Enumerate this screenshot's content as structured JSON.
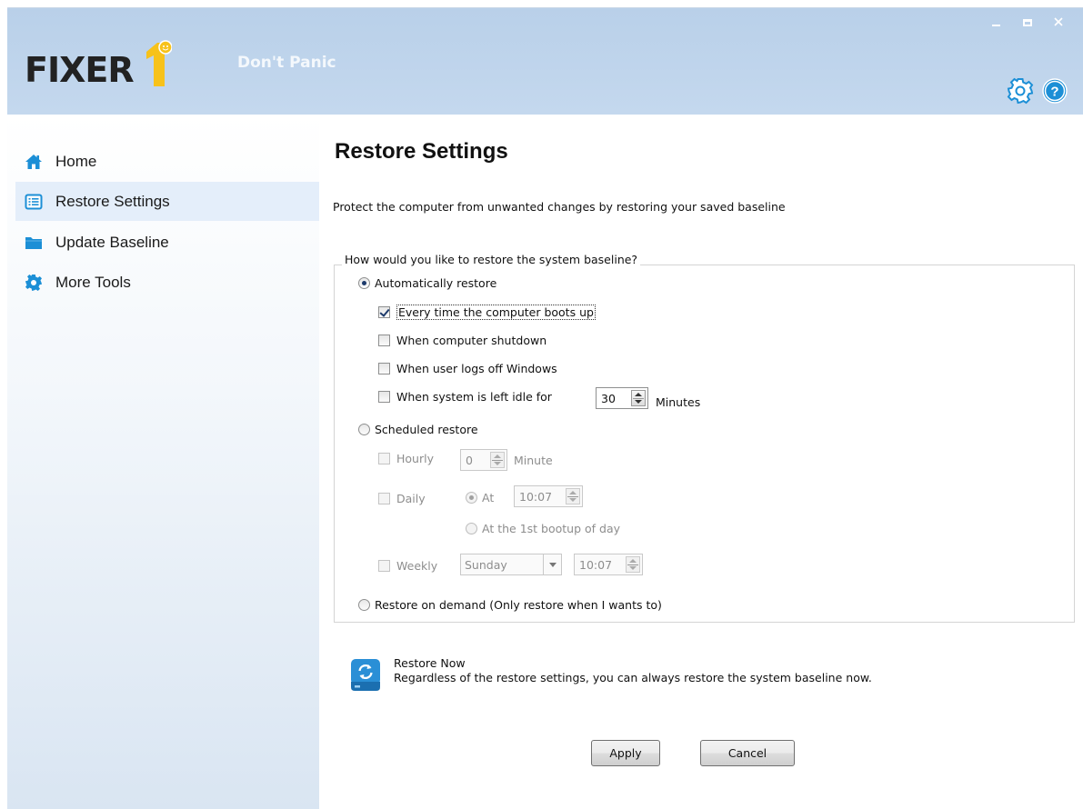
{
  "app": {
    "logo_text": "FIXER",
    "tagline": "Don't Panic"
  },
  "sidebar": {
    "items": [
      {
        "label": "Home",
        "icon": "home-icon",
        "active": false
      },
      {
        "label": "Restore Settings",
        "icon": "list-icon",
        "active": true
      },
      {
        "label": "Update Baseline",
        "icon": "folder-icon",
        "active": false
      },
      {
        "label": "More Tools",
        "icon": "gear-icon",
        "active": false
      }
    ]
  },
  "main": {
    "title": "Restore Settings",
    "description": "Protect the computer from unwanted changes by restoring your saved baseline",
    "group_label": "How would you like to restore the system baseline?",
    "auto_restore": {
      "label": "Automatically restore",
      "selected": true,
      "boot_label": "Every time the computer boots up",
      "boot_checked": true,
      "shutdown_label": "When computer shutdown",
      "shutdown_checked": false,
      "logoff_label": "When user logs off Windows",
      "logoff_checked": false,
      "idle_label": "When system is left idle for",
      "idle_checked": false,
      "idle_value": "30",
      "idle_unit": "Minutes"
    },
    "scheduled_restore": {
      "label": "Scheduled restore",
      "selected": false,
      "hourly_label": "Hourly",
      "hourly_value": "0",
      "hourly_unit": "Minute",
      "daily_label": "Daily",
      "daily_at_label": "At",
      "daily_time": "10:07",
      "daily_first_boot_label": "At the 1st bootup of day",
      "weekly_label": "Weekly",
      "weekly_day": "Sunday",
      "weekly_time": "10:07"
    },
    "on_demand": {
      "label": "Restore on demand (Only restore when I wants to)",
      "selected": false
    },
    "restore_now": {
      "title": "Restore Now",
      "description": "Regardless of the restore settings, you can always restore the system baseline now."
    },
    "buttons": {
      "apply": "Apply",
      "cancel": "Cancel"
    }
  },
  "colors": {
    "header_bg": "#bcd2ea",
    "sidebar_active": "#e4eefa",
    "accent_blue": "#1c8fd6",
    "logo_yellow": "#f7c21a"
  }
}
